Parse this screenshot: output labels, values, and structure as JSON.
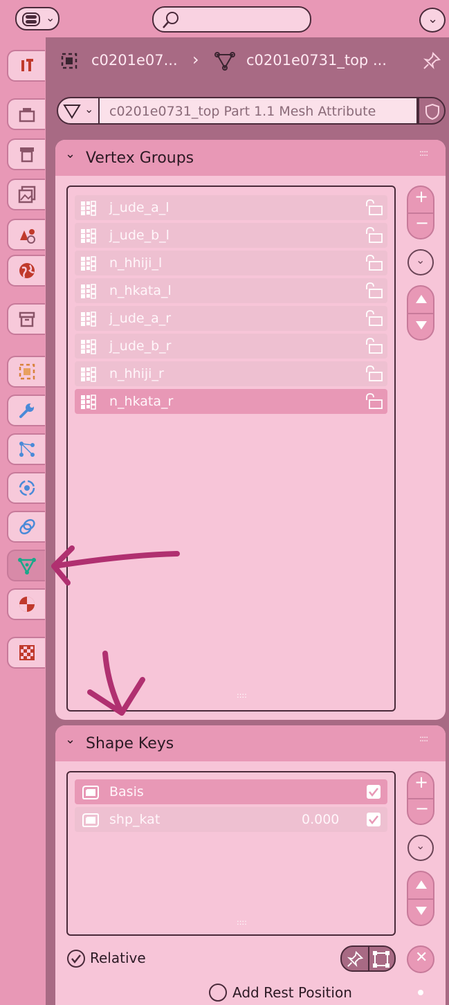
{
  "colors": {
    "bg": "#e898b6",
    "panel": "#f7c5d8",
    "header": "#e898b6",
    "dark": "#a86a84",
    "row": "#eec0d1",
    "selected": "#e898b6",
    "text": "#2c1a24",
    "light_text": "#fff6fa",
    "annotation": "#b03070"
  },
  "header": {
    "editor_type_icon": "editor-type-icon",
    "search_icon": "search-icon",
    "menu_icon": "chevron-down-icon"
  },
  "tabs": [
    "tool",
    "render",
    "output",
    "view-layer",
    "scene",
    "world",
    "collection",
    "object",
    "modifiers",
    "particles",
    "physics",
    "constraints",
    "data",
    "material",
    "texture"
  ],
  "breadcrumb": {
    "object": "c0201e07...",
    "separator": "›",
    "mesh": "c0201e0731_top ...",
    "pin_icon": "pin-icon"
  },
  "datablock": {
    "name": "c0201e0731_top Part 1.1 Mesh Attribute",
    "shield_icon": "shield-icon"
  },
  "vertex_groups": {
    "title": "Vertex Groups",
    "items": [
      "j_ude_a_l",
      "j_ude_b_l",
      "n_hhiji_l",
      "n_hkata_l",
      "j_ude_a_r",
      "j_ude_b_r",
      "n_hhiji_r",
      "n_hkata_r"
    ],
    "selected_index": 7,
    "resize_grip": "::::"
  },
  "shape_keys": {
    "title": "Shape Keys",
    "items": [
      {
        "name": "Basis",
        "value": ""
      },
      {
        "name": "shp_kat",
        "value": "0.000"
      }
    ],
    "selected_index": 0,
    "resize_grip": "::::",
    "relative_label": "Relative",
    "add_rest_label": "Add Rest Position"
  }
}
